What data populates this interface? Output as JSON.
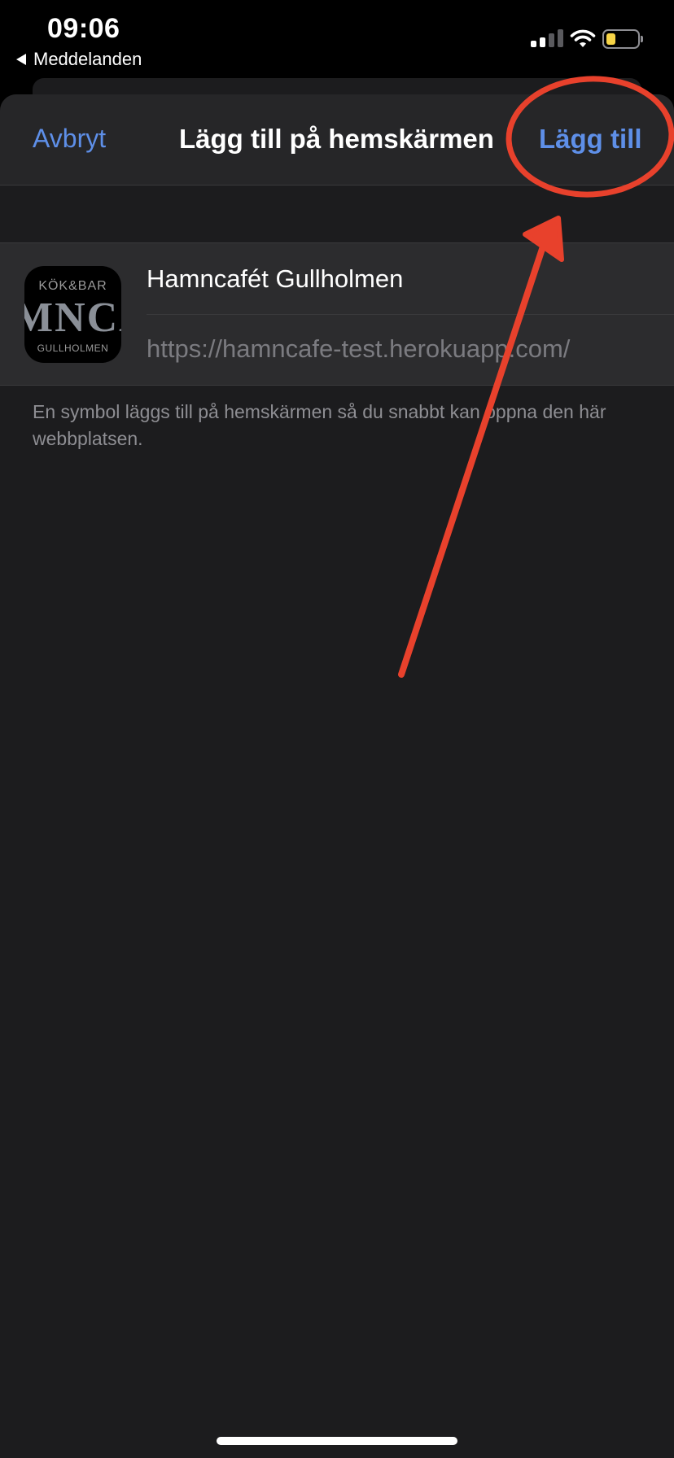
{
  "status_bar": {
    "time": "09:06",
    "back_label": "Meddelanden",
    "signal_icon": "cellular-signal-icon",
    "wifi_icon": "wifi-icon",
    "battery_icon": "battery-icon",
    "battery_level": 0.3,
    "battery_color": "#f7d447"
  },
  "nav": {
    "cancel_label": "Avbryt",
    "title": "Lägg till på hemskärmen",
    "add_label": "Lägg till"
  },
  "bookmark": {
    "icon_lines": [
      "KÖK&BAR",
      "MNCA",
      "GULLHOLMEN"
    ],
    "name_value": "Hamncafét Gullholmen",
    "url": "https://hamncafe-test.herokuapp.com/"
  },
  "footnote": "En symbol läggs till på hemskärmen så du snabbt kan öppna den här webbplatsen.",
  "colors": {
    "accent": "#5e8fe8",
    "annotation": "#e8412c",
    "sheet_background": "#1c1c1e"
  }
}
